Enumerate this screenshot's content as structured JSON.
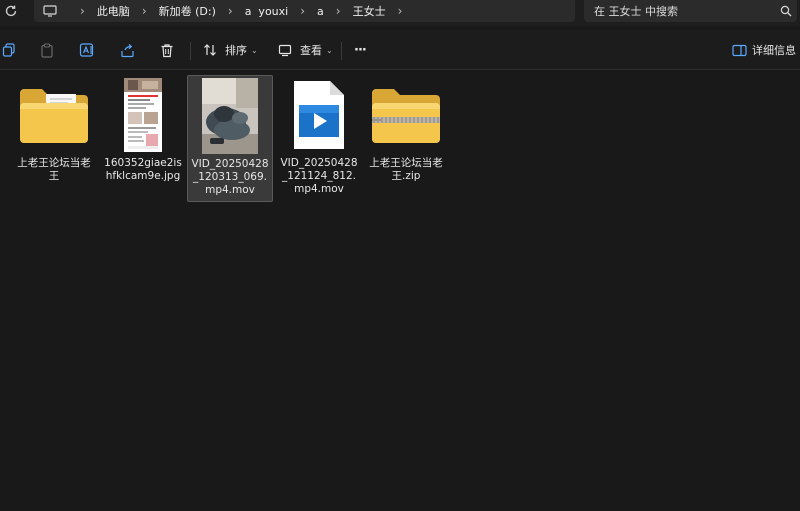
{
  "address_bar": {
    "crumbs": [
      "此电脑",
      "新加卷 (D:)",
      "a  youxi",
      "a",
      "王女士"
    ]
  },
  "search": {
    "placeholder": "在 王女士 中搜索"
  },
  "toolbar": {
    "sort_label": "排序",
    "view_label": "查看",
    "more_label": "···",
    "details_label": "详细信息"
  },
  "files": [
    {
      "name": "上老王论坛当老王",
      "type": "folder"
    },
    {
      "name": "160352giae2ishfklcam9e.jpg",
      "type": "image"
    },
    {
      "name": "VID_20250428_120313_069.mp4.mov",
      "type": "video-thumb",
      "selected": true
    },
    {
      "name": "VID_20250428_121124_812.mp4.mov",
      "type": "video-file"
    },
    {
      "name": "上老王论坛当老王.zip",
      "type": "zip-folder"
    }
  ],
  "colors": {
    "folder": "#f4c64c",
    "background": "#191919",
    "selected": "#3a3a3a",
    "media_blue": "#1a73c9"
  }
}
